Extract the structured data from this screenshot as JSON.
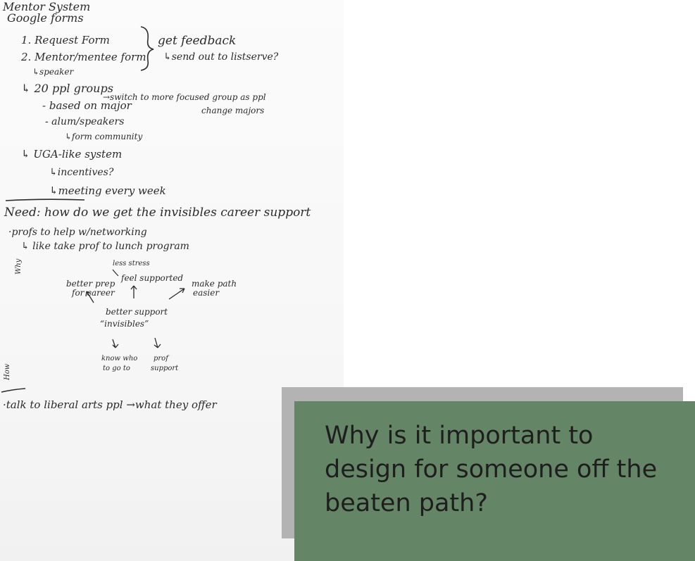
{
  "notes": {
    "title": "Mentor System",
    "google_forms": "Google forms",
    "request_form": "1. Request Form",
    "mentor_form": "2. Mentor/mentee form",
    "speaker": "↳speaker",
    "get_feedback": "get feedback",
    "listserve": "↳send out to listserve?",
    "groups": "↳ 20 ppl groups",
    "switch_focus": "→switch to more focused group as ppl",
    "change_majors": "change majors",
    "based_on_major": "- based on major",
    "alum_speakers": "- alum/speakers",
    "form_community": "↳form community",
    "uga_system": "↳ UGA-like system",
    "incentives": "↳incentives?",
    "meeting_weekly": "↳meeting every week",
    "need": "Need: how do we get the invisibles career support",
    "profs_networking": "·profs to help w/networking",
    "lunch_program": "↳ like take prof to lunch program",
    "why": "Why",
    "less_stress": "less stress",
    "better_prep": "better prep",
    "for_career": "for career",
    "feel_supported": "feel supported",
    "make_path": "make path",
    "easier": "easier",
    "better_support": "better support",
    "invisibles": "“invisibles”",
    "know_who": "know who",
    "to_go_to": "to go to",
    "prof": "prof",
    "support": "support",
    "how": "How",
    "liberal_arts": "·talk to liberal arts ppl →what they offer"
  },
  "question": "Why is it important to design for someone off the beaten path?",
  "colors": {
    "card_green": "#658567",
    "card_shadow": "#b3b3b3",
    "ink": "#2b2b2b"
  }
}
